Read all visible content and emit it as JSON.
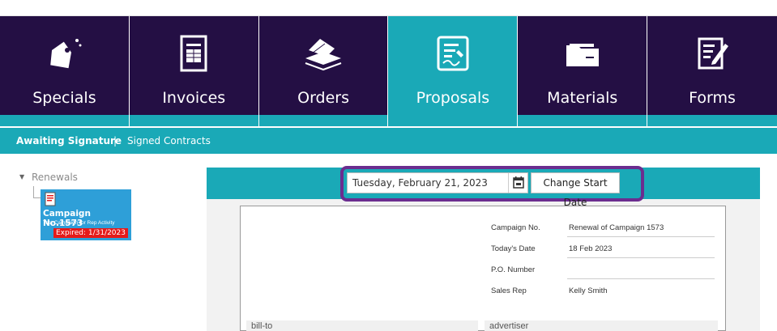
{
  "nav_tiles": [
    {
      "label": "Specials",
      "icon": "tag-icon"
    },
    {
      "label": "Invoices",
      "icon": "invoice-icon"
    },
    {
      "label": "Orders",
      "icon": "orders-stack-icon"
    },
    {
      "label": "Proposals",
      "icon": "proposal-icon",
      "active": true
    },
    {
      "label": "Materials",
      "icon": "folder-icon"
    },
    {
      "label": "Forms",
      "icon": "form-edit-icon"
    }
  ],
  "subnav": {
    "items": [
      "Awaiting Signature",
      "Signed Contracts"
    ],
    "separator": "|",
    "active": "Awaiting Signature"
  },
  "tree": {
    "group_label": "Renewals",
    "card": {
      "title": "Campaign No.1573",
      "subtitle": "Test Campaign for Rep Activity",
      "status": "Expired: 1/31/2023"
    }
  },
  "toolbar": {
    "date_value": "Tuesday, February 21, 2023",
    "start_button": "Change Start Date"
  },
  "document": {
    "fields": [
      {
        "label": "Campaign No.",
        "value": "Renewal of Campaign 1573"
      },
      {
        "label": "Today's Date",
        "value": "18 Feb 2023"
      },
      {
        "label": "P.O. Number",
        "value": ""
      },
      {
        "label": "Sales Rep",
        "value": "Kelly Smith"
      }
    ],
    "sections": [
      "bill-to",
      "advertiser"
    ]
  },
  "colors": {
    "tile_dark": "#240f44",
    "teal": "#1aa9b7",
    "highlight": "#6b2d8f",
    "card_blue": "#2e9fd8",
    "expired_red": "#e51a1a"
  }
}
